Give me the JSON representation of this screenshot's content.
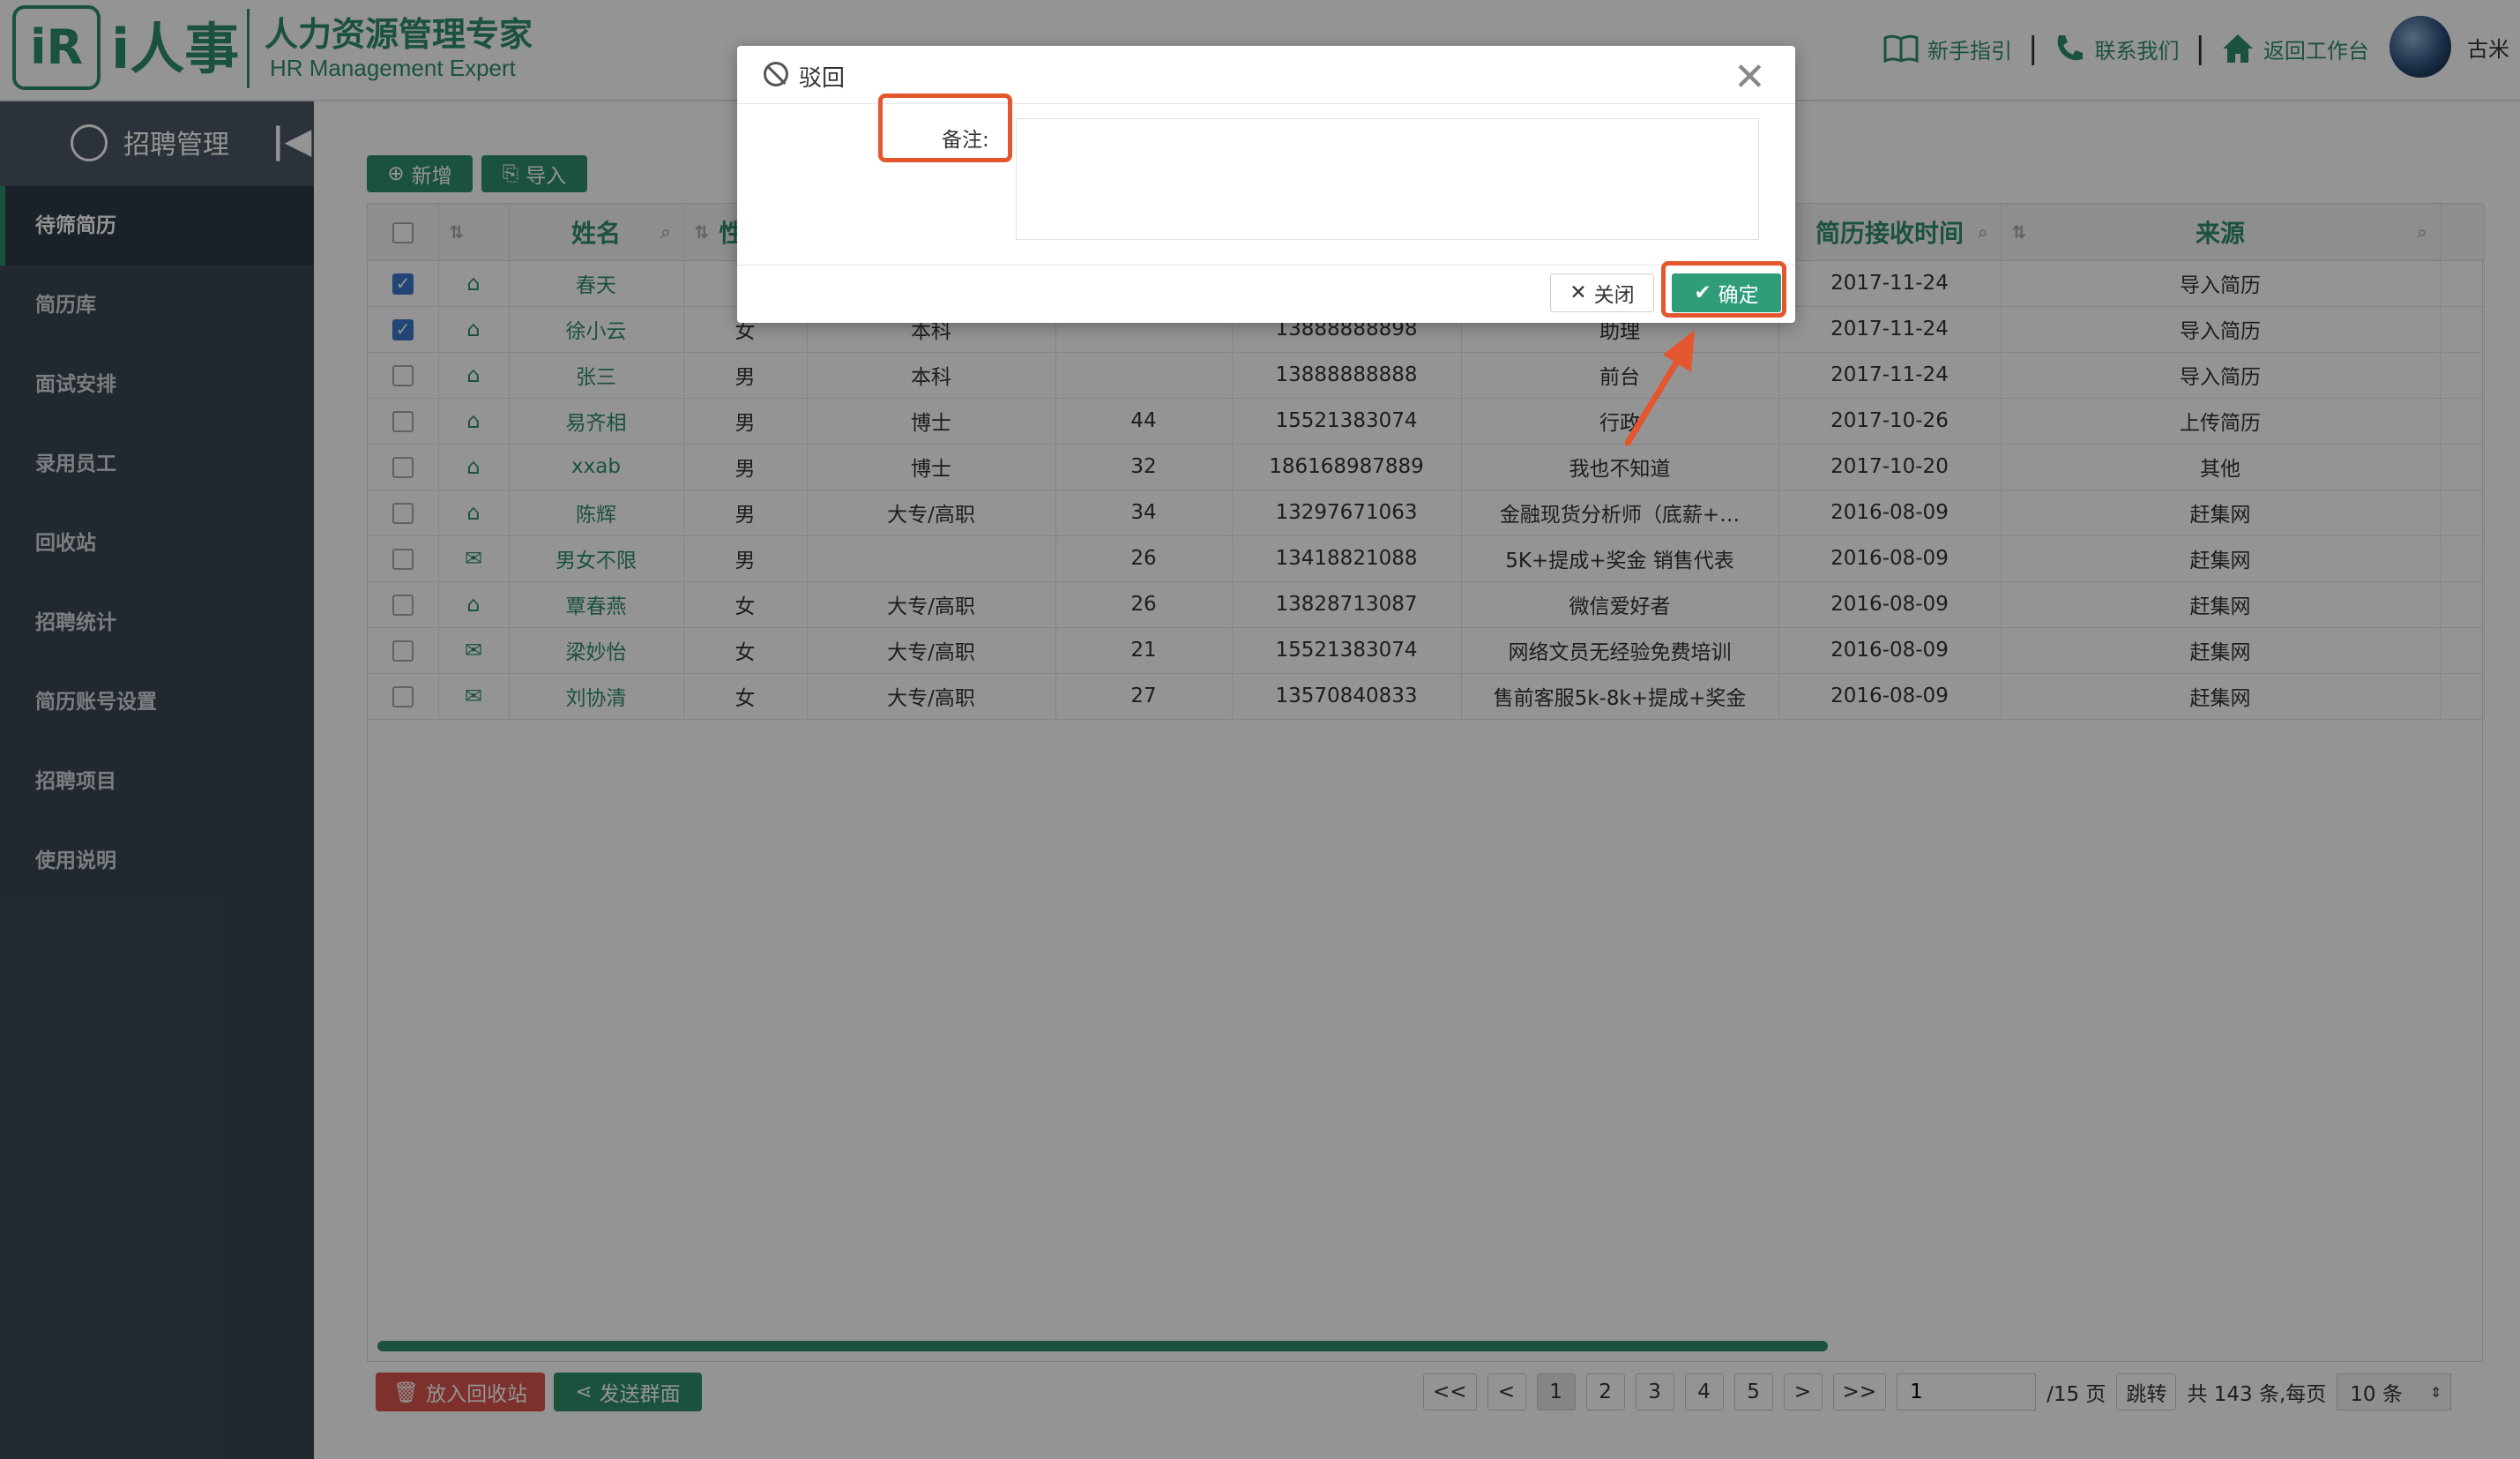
{
  "header": {
    "logo_mark": "iR",
    "logo_text": "i人事",
    "slogan_cn": "人力资源管理专家",
    "slogan_en": "HR Management Expert",
    "links": [
      {
        "label": "新手指引",
        "icon": "book-icon"
      },
      {
        "label": "联系我们",
        "icon": "phone-icon"
      },
      {
        "label": "返回工作台",
        "icon": "home-icon"
      }
    ],
    "username": "古米"
  },
  "sidebar": {
    "title": "招聘管理",
    "items": [
      {
        "label": "待筛简历",
        "active": true
      },
      {
        "label": "简历库"
      },
      {
        "label": "面试安排"
      },
      {
        "label": "录用员工"
      },
      {
        "label": "回收站"
      },
      {
        "label": "招聘统计"
      },
      {
        "label": "简历账号设置"
      },
      {
        "label": "招聘项目"
      },
      {
        "label": "使用说明"
      }
    ]
  },
  "toolbar": {
    "add_label": "新增",
    "import_label": "导入"
  },
  "table": {
    "headers": {
      "name": "姓名",
      "gender": "性",
      "received": "简历接收时间",
      "source": "来源"
    },
    "rows": [
      {
        "checked": true,
        "icon": "open-mail",
        "name": "春天",
        "gender": "",
        "edu": "",
        "age": "",
        "phone": "",
        "position": "",
        "date": "2017-11-24",
        "source": "导入简历"
      },
      {
        "checked": true,
        "icon": "open-mail",
        "name": "徐小云",
        "gender": "女",
        "edu": "本科",
        "age": "",
        "phone": "13888888898",
        "position": "助理",
        "date": "2017-11-24",
        "source": "导入简历"
      },
      {
        "checked": false,
        "icon": "open-mail",
        "name": "张三",
        "gender": "男",
        "edu": "本科",
        "age": "",
        "phone": "13888888888",
        "position": "前台",
        "date": "2017-11-24",
        "source": "导入简历"
      },
      {
        "checked": false,
        "icon": "open-mail",
        "name": "易齐相",
        "gender": "男",
        "edu": "博士",
        "age": "44",
        "phone": "15521383074",
        "position": "行政",
        "date": "2017-10-26",
        "source": "上传简历"
      },
      {
        "checked": false,
        "icon": "open-mail",
        "name": "xxab",
        "gender": "男",
        "edu": "博士",
        "age": "32",
        "phone": "186168987889",
        "position": "我也不知道",
        "date": "2017-10-20",
        "source": "其他"
      },
      {
        "checked": false,
        "icon": "open-mail",
        "name": "陈辉",
        "gender": "男",
        "edu": "大专/高职",
        "age": "34",
        "phone": "13297671063",
        "position": "金融现货分析师（底薪+…",
        "date": "2016-08-09",
        "source": "赶集网"
      },
      {
        "checked": false,
        "icon": "mail",
        "name": "男女不限",
        "gender": "男",
        "edu": "",
        "age": "26",
        "phone": "13418821088",
        "position": "5K+提成+奖金 销售代表",
        "date": "2016-08-09",
        "source": "赶集网"
      },
      {
        "checked": false,
        "icon": "open-mail",
        "name": "覃春燕",
        "gender": "女",
        "edu": "大专/高职",
        "age": "26",
        "phone": "13828713087",
        "position": "微信爱好者",
        "date": "2016-08-09",
        "source": "赶集网"
      },
      {
        "checked": false,
        "icon": "mail",
        "name": "梁妙怡",
        "gender": "女",
        "edu": "大专/高职",
        "age": "21",
        "phone": "15521383074",
        "position": "网络文员无经验免费培训",
        "date": "2016-08-09",
        "source": "赶集网"
      },
      {
        "checked": false,
        "icon": "mail",
        "name": "刘协清",
        "gender": "女",
        "edu": "大专/高职",
        "age": "27",
        "phone": "13570840833",
        "position": "售前客服5k-8k+提成+奖金",
        "date": "2016-08-09",
        "source": "赶集网"
      }
    ]
  },
  "footer": {
    "recycle_label": "放入回收站",
    "send_label": "发送群面",
    "pager": {
      "first": "<<",
      "prev": "<",
      "pages": [
        "1",
        "2",
        "3",
        "4",
        "5"
      ],
      "next": ">",
      "last": ">>",
      "current": "1",
      "jump_value": "1",
      "total_pages": "/15 页",
      "jump_label": "跳转",
      "summary": "共 143 条,每页",
      "page_size": "10 条"
    }
  },
  "modal": {
    "title": "驳回",
    "remark_label": "备注:",
    "remark_value": "",
    "close_label": "关闭",
    "ok_label": "确定"
  },
  "colors": {
    "brand": "#2f8d6a",
    "sidebar": "#3a4652",
    "danger": "#d9534f",
    "highlight": "#e4572e"
  }
}
